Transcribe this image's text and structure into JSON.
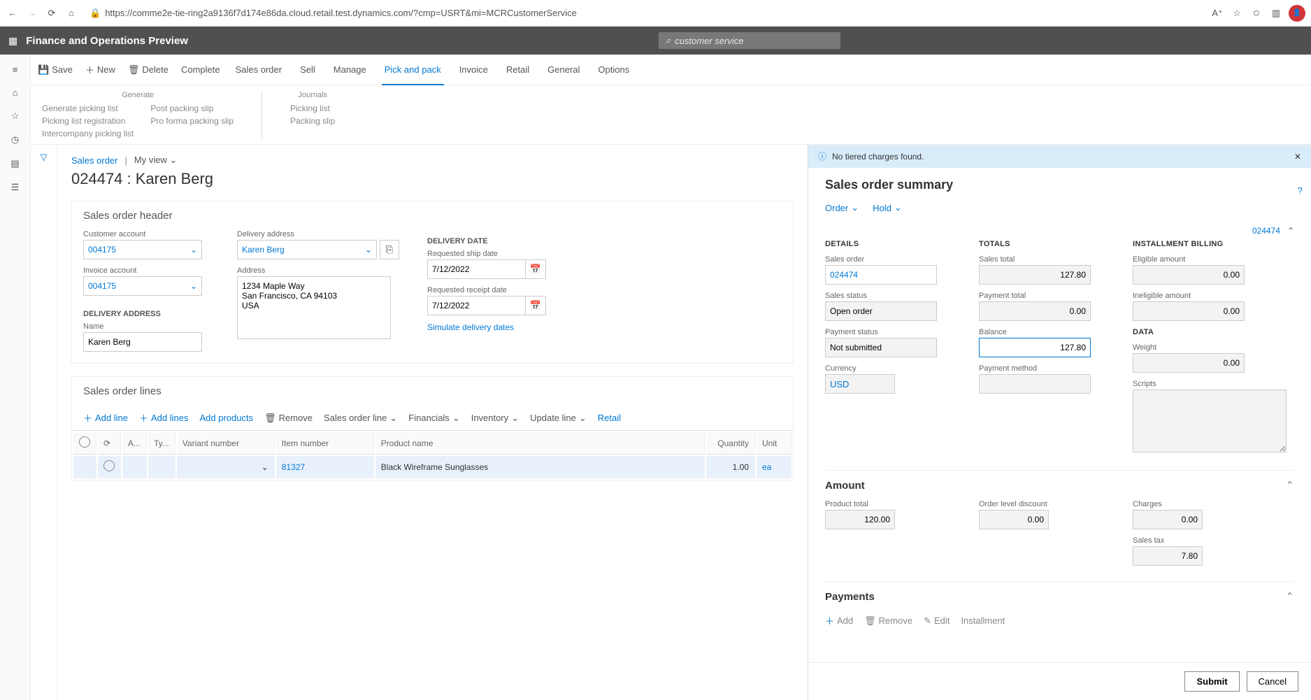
{
  "browser": {
    "url": "https://comme2e-tie-ring2a9136f7d174e86da.cloud.retail.test.dynamics.com/?cmp=USRT&mi=MCRCustomerService"
  },
  "app": {
    "title": "Finance and Operations Preview",
    "search_text": "customer service"
  },
  "cmd": {
    "save": "Save",
    "new": "New",
    "delete": "Delete",
    "complete": "Complete",
    "tabs": [
      "Sales order",
      "Sell",
      "Manage",
      "Pick and pack",
      "Invoice",
      "Retail",
      "General",
      "Options"
    ]
  },
  "ribbon": {
    "generate": {
      "title": "Generate",
      "col1": [
        "Generate picking list",
        "Picking list registration",
        "Intercompany picking list"
      ],
      "col2": [
        "Post packing slip",
        "Pro forma packing slip"
      ]
    },
    "journals": {
      "title": "Journals",
      "items": [
        "Picking list",
        "Packing slip"
      ]
    }
  },
  "breadcrumb": {
    "sales_order": "Sales order",
    "my_view": "My view"
  },
  "page_title": "024474 : Karen Berg",
  "header_section": {
    "title": "Sales order header",
    "customer_account_label": "Customer account",
    "customer_account": "004175",
    "invoice_account_label": "Invoice account",
    "invoice_account": "004175",
    "delivery_address_head": "DELIVERY ADDRESS",
    "name_label": "Name",
    "name": "Karen Berg",
    "delivery_address_label": "Delivery address",
    "delivery_address_sel": "Karen Berg",
    "address_label": "Address",
    "address_text": "1234 Maple Way\nSan Francisco, CA 94103\nUSA",
    "delivery_date_head": "DELIVERY DATE",
    "req_ship_label": "Requested ship date",
    "req_ship": "7/12/2022",
    "req_receipt_label": "Requested receipt date",
    "req_receipt": "7/12/2022",
    "simulate_link": "Simulate delivery dates"
  },
  "lines_section": {
    "title": "Sales order lines",
    "toolbar": {
      "add_line": "Add line",
      "add_lines": "Add lines",
      "add_products": "Add products",
      "remove": "Remove",
      "sales_order_line": "Sales order line",
      "financials": "Financials",
      "inventory": "Inventory",
      "update_line": "Update line",
      "retail": "Retail"
    },
    "columns": [
      "",
      "",
      "A...",
      "Ty...",
      "Variant number",
      "Item number",
      "Product name",
      "Quantity",
      "Unit"
    ],
    "row": {
      "item_number": "81327",
      "product_name": "Black Wireframe Sunglasses",
      "quantity": "1.00",
      "unit": "ea"
    }
  },
  "panel": {
    "info_msg": "No tiered charges found.",
    "title": "Sales order summary",
    "order": "Order",
    "hold": "Hold",
    "order_num": "024474",
    "details": {
      "head": "DETAILS",
      "sales_order_label": "Sales order",
      "sales_order": "024474",
      "sales_status_label": "Sales status",
      "sales_status": "Open order",
      "payment_status_label": "Payment status",
      "payment_status": "Not submitted",
      "currency_label": "Currency",
      "currency": "USD"
    },
    "totals": {
      "head": "TOTALS",
      "sales_total_label": "Sales total",
      "sales_total": "127.80",
      "payment_total_label": "Payment total",
      "payment_total": "0.00",
      "balance_label": "Balance",
      "balance": "127.80",
      "payment_method_label": "Payment method",
      "payment_method": ""
    },
    "installment": {
      "head": "INSTALLMENT BILLING",
      "eligible_label": "Eligible amount",
      "eligible": "0.00",
      "ineligible_label": "Ineligible amount",
      "ineligible": "0.00",
      "data_head": "DATA",
      "weight_label": "Weight",
      "weight": "0.00",
      "scripts_label": "Scripts"
    },
    "amount": {
      "head": "Amount",
      "product_total_label": "Product total",
      "product_total": "120.00",
      "order_discount_label": "Order level discount",
      "order_discount": "0.00",
      "charges_label": "Charges",
      "charges": "0.00",
      "sales_tax_label": "Sales tax",
      "sales_tax": "7.80"
    },
    "payments": {
      "head": "Payments",
      "add": "Add",
      "remove": "Remove",
      "edit": "Edit",
      "installment": "Installment"
    },
    "footer": {
      "submit": "Submit",
      "cancel": "Cancel"
    }
  }
}
